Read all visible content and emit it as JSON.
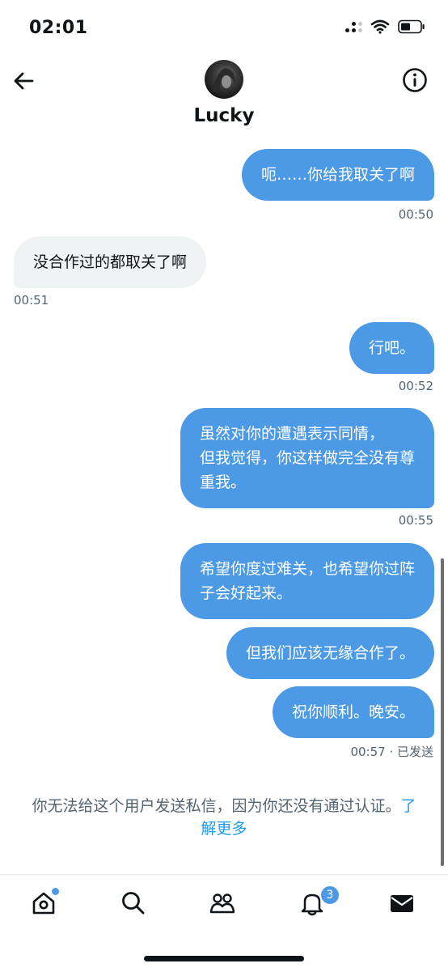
{
  "status_bar": {
    "time": "02:01"
  },
  "header": {
    "name": "Lucky"
  },
  "messages": [
    {
      "text": "呃……你给我取关了啊",
      "time": "00:50"
    },
    {
      "text": "没合作过的都取关了啊",
      "time": "00:51"
    },
    {
      "text": "行吧。",
      "time": "00:52"
    },
    {
      "line1": "虽然对你的遭遇表示同情，",
      "line2": "但我觉得，你这样做完全没有尊",
      "line3": "重我。",
      "time": "00:55"
    },
    {
      "line1": "希望你度过难关，也希望你过阵",
      "line2": "子会好起来。"
    },
    {
      "text": "但我们应该无缘合作了。"
    },
    {
      "text": "祝你顺利。晚安。",
      "time": "00:57 · 已发送"
    }
  ],
  "notice": {
    "text": "你无法给这个用户发送私信，因为你还没有通过认证。",
    "link_part1": "了",
    "link_part2": "解更多"
  },
  "tabbar": {
    "notifications_badge": "3"
  },
  "colors": {
    "outgoing_bubble": "#4c9ae6",
    "incoming_bubble": "#eff3f4",
    "link": "#1d9bf0"
  }
}
